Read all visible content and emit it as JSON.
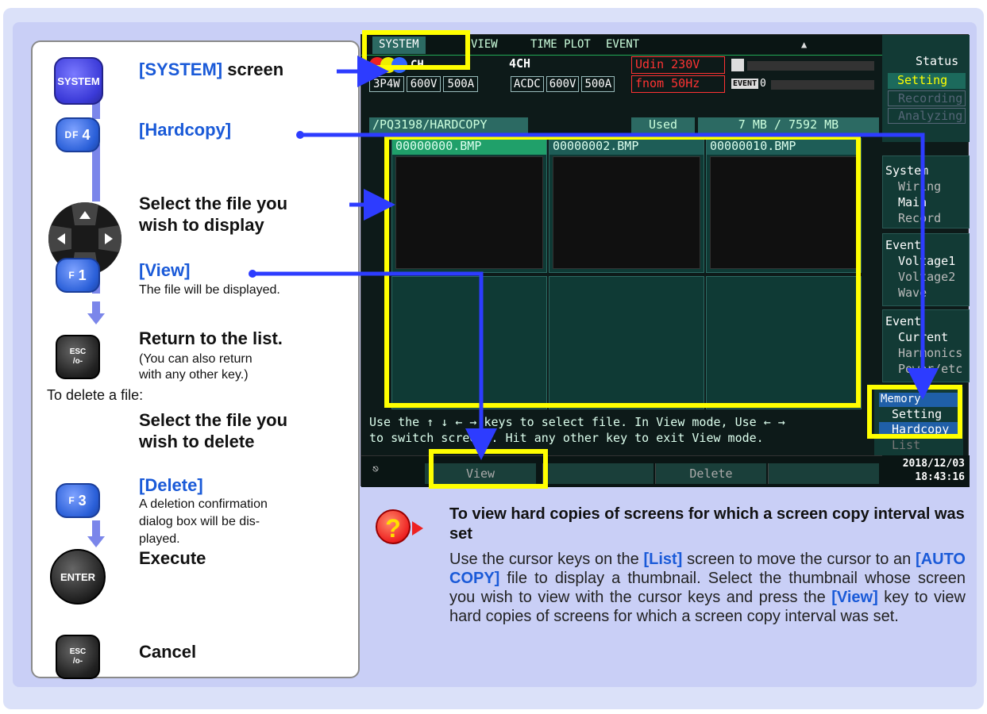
{
  "steps": [
    {
      "key": "SYSTEM",
      "label_bracket": "[SYSTEM]",
      "label_rest": " screen"
    },
    {
      "key_main": "4",
      "key_prefix": "DF",
      "label": "[Hardcopy]"
    },
    {
      "label1": "Select the file you",
      "label2": "wish to display"
    },
    {
      "key_main": "1",
      "key_prefix": "F",
      "label": "[View]",
      "note": "The file will be displayed."
    },
    {
      "key": "ESC",
      "key_sub": "/o-",
      "label": "Return to the list.",
      "note1": "(You can also return",
      "note2": "with any other key.)"
    }
  ],
  "delete_intro": "To delete a file:",
  "delete_steps": [
    {
      "label1": "Select the file you",
      "label2": "wish to delete"
    },
    {
      "key_main": "3",
      "key_prefix": "F",
      "label": "[Delete]",
      "note1": "A deletion confirmation",
      "note2": "dialog box will be dis-",
      "note3": "played."
    },
    {
      "key": "ENTER",
      "label": "Execute"
    },
    {
      "key": "ESC",
      "key_sub": "/o-",
      "label": "Cancel"
    }
  ],
  "screen": {
    "tabs": [
      "SYSTEM",
      "VIEW",
      "TIME PLOT",
      "EVENT"
    ],
    "ch_left": "CH",
    "ch4": "4CH",
    "wiring": [
      "3P4W",
      "600V",
      "500A"
    ],
    "ch4_vals": [
      "ACDC",
      "600V",
      "500A"
    ],
    "udin": "Udin 230V",
    "fnom": "fnom  50Hz",
    "event_label": "EVENT",
    "event_count": "0",
    "status_title": "Status",
    "status_items": [
      "Setting",
      "Recording",
      "Analyzing"
    ],
    "path": "/PQ3198/HARDCOPY",
    "used_label": "Used",
    "used_value": "7 MB /  7592 MB",
    "files": [
      "00000000.BMP",
      "00000002.BMP",
      "00000010.BMP"
    ],
    "side_groups": [
      {
        "title": "System",
        "items": [
          "Wiring",
          "Main",
          "Record"
        ]
      },
      {
        "title": "Event",
        "items": [
          "Voltage1",
          "Voltage2",
          "Wave"
        ]
      },
      {
        "title": "Event",
        "items": [
          "Current",
          "Harmonics",
          "Power/etc"
        ]
      }
    ],
    "memory_title": "Memory",
    "memory_items": [
      "Setting",
      "Hardcopy",
      "List"
    ],
    "help_line1": "Use the ↑ ↓ ← → keys to select file. In View mode, Use ← →",
    "help_line2": "to switch screens. Hit any other key to exit View mode.",
    "fkeys": [
      "View",
      "",
      "Delete",
      ""
    ],
    "date": "2018/12/03",
    "time": "18:43:16"
  },
  "help": {
    "title": "To view hard copies of screens for which a screen copy interval was set",
    "p_pre1": "Use the cursor keys on the ",
    "list_key": "[List]",
    "p_mid1": " screen to move the cursor to an ",
    "autocopy": "[AUTO COPY]",
    "p_mid2": " file to display a thumbnail. Select the thumbnail whose screen you wish to view with the cursor keys and press the ",
    "view_key": "[View]",
    "p_end": " key to view hard copies of screens for which a screen copy interval was set."
  },
  "colors": {
    "accent_blue": "#1a5ad8",
    "highlight": "#ffff00",
    "arrow": "#2d3cff",
    "flow": "#7b86ea"
  }
}
